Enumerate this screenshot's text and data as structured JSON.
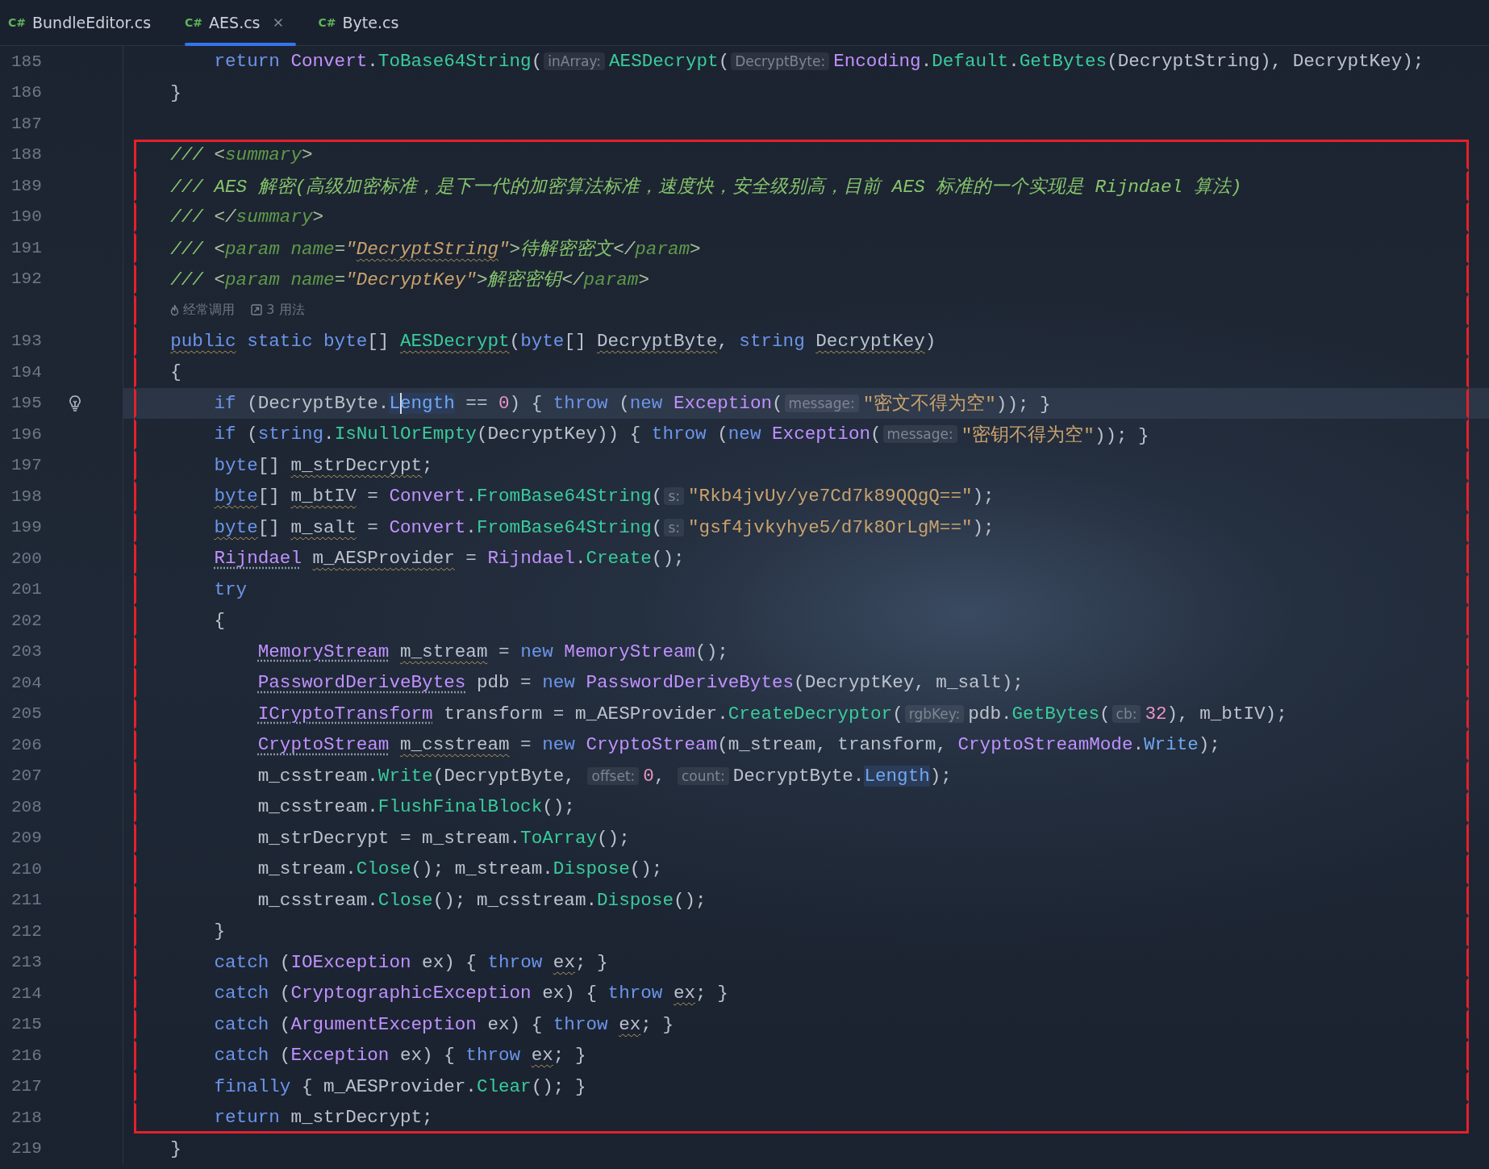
{
  "tabs": [
    {
      "lang": "C#",
      "label": "BundleEditor.cs",
      "selected": false
    },
    {
      "lang": "C#",
      "label": "AES.cs",
      "selected": true
    },
    {
      "lang": "C#",
      "label": "Byte.cs",
      "selected": false
    }
  ],
  "lines": [
    {
      "kind": "code",
      "number": "185",
      "boxed": false,
      "current": false,
      "tokens": [
        {
          "kind": "kw",
          "text": "        return"
        },
        {
          "kind": "type",
          "text": " Convert"
        },
        {
          "kind": "plain",
          "text": "."
        },
        {
          "kind": "method",
          "text": "ToBase64String"
        },
        {
          "kind": "plain",
          "text": "("
        },
        {
          "kind": "hint",
          "text": "inArray:"
        },
        {
          "kind": "method",
          "text": "AESDecrypt"
        },
        {
          "kind": "plain",
          "text": "("
        },
        {
          "kind": "hint",
          "text": "DecryptByte:"
        },
        {
          "kind": "type",
          "text": "Encoding"
        },
        {
          "kind": "plain",
          "text": "."
        },
        {
          "kind": "method",
          "text": "Default"
        },
        {
          "kind": "plain",
          "text": "."
        },
        {
          "kind": "method",
          "text": "GetBytes"
        },
        {
          "kind": "plain",
          "text": "(DecryptString), DecryptKey);"
        }
      ]
    },
    {
      "kind": "code",
      "number": "186",
      "boxed": false,
      "current": false,
      "tokens": [
        {
          "kind": "plain",
          "text": "    }"
        }
      ]
    },
    {
      "kind": "code",
      "number": "187",
      "boxed": false,
      "current": false
    },
    {
      "kind": "code",
      "number": "188",
      "boxed": true,
      "current": false,
      "tokens": [
        {
          "kind": "doc-slash",
          "text": "    ///"
        },
        {
          "kind": "doc-punct",
          "text": " <"
        },
        {
          "kind": "doc-tag",
          "text": "summary"
        },
        {
          "kind": "doc-punct",
          "text": ">"
        }
      ]
    },
    {
      "kind": "code",
      "number": "189",
      "boxed": true,
      "current": false,
      "tokens": [
        {
          "kind": "doc-slash",
          "text": "    ///"
        },
        {
          "kind": "comment",
          "text": " AES 解密(高级加密标准，是下一代的加密算法标准，速度快，安全级别高，目前 AES 标准的一个实现是 Rijndael 算法)"
        }
      ]
    },
    {
      "kind": "code",
      "number": "190",
      "boxed": true,
      "current": false,
      "tokens": [
        {
          "kind": "doc-slash",
          "text": "    ///"
        },
        {
          "kind": "doc-punct",
          "text": " </"
        },
        {
          "kind": "doc-tag",
          "text": "summary"
        },
        {
          "kind": "doc-punct",
          "text": ">"
        }
      ]
    },
    {
      "kind": "code",
      "number": "191",
      "boxed": true,
      "current": false,
      "tokens": [
        {
          "kind": "doc-slash",
          "text": "    ///"
        },
        {
          "kind": "doc-punct",
          "text": " <"
        },
        {
          "kind": "doc-tag",
          "text": "param name"
        },
        {
          "kind": "doc-punct",
          "text": "="
        },
        {
          "kind": "doc-value",
          "text": "\""
        },
        {
          "kind": "doc-value",
          "text": "DecryptString",
          "warning": true
        },
        {
          "kind": "doc-value",
          "text": "\""
        },
        {
          "kind": "doc-punct",
          "text": ">"
        },
        {
          "kind": "comment",
          "text": "待解密密文"
        },
        {
          "kind": "doc-punct",
          "text": "</"
        },
        {
          "kind": "doc-tag",
          "text": "param"
        },
        {
          "kind": "doc-punct",
          "text": ">"
        }
      ]
    },
    {
      "kind": "code",
      "number": "192",
      "boxed": true,
      "current": false,
      "tokens": [
        {
          "kind": "doc-slash",
          "text": "    ///"
        },
        {
          "kind": "doc-punct",
          "text": " <"
        },
        {
          "kind": "doc-tag",
          "text": "param name"
        },
        {
          "kind": "doc-punct",
          "text": "="
        },
        {
          "kind": "doc-value",
          "text": "\"DecryptKey\""
        },
        {
          "kind": "doc-punct",
          "text": ">"
        },
        {
          "kind": "comment",
          "text": "解密密钥"
        },
        {
          "kind": "doc-punct",
          "text": "</"
        },
        {
          "kind": "doc-tag",
          "text": "param"
        },
        {
          "kind": "doc-punct",
          "text": ">"
        }
      ]
    },
    {
      "kind": "inlay",
      "boxed": true,
      "items": [
        {
          "kind": "flame",
          "text": "经常调用"
        },
        {
          "kind": "usages",
          "text": "3 用法"
        }
      ]
    },
    {
      "kind": "code",
      "number": "193",
      "boxed": true,
      "current": false,
      "tokens": [
        {
          "kind": "kw",
          "text": "    public",
          "warning": true
        },
        {
          "kind": "kw",
          "text": " static byte"
        },
        {
          "kind": "plain",
          "text": "[] "
        },
        {
          "kind": "method",
          "text": "AESDecrypt",
          "warning": true
        },
        {
          "kind": "plain",
          "text": "("
        },
        {
          "kind": "kw",
          "text": "byte"
        },
        {
          "kind": "plain",
          "text": "[] "
        },
        {
          "kind": "plain",
          "text": "DecryptByte",
          "warning": true
        },
        {
          "kind": "plain",
          "text": ", "
        },
        {
          "kind": "kw",
          "text": "string"
        },
        {
          "kind": "plain",
          "text": " DecryptKey",
          "warning": true
        },
        {
          "kind": "plain",
          "text": ")"
        }
      ]
    },
    {
      "kind": "code",
      "number": "194",
      "boxed": true,
      "current": false,
      "tokens": [
        {
          "kind": "plain",
          "text": "    {"
        }
      ]
    },
    {
      "kind": "code",
      "number": "195",
      "boxed": true,
      "current": true,
      "tokens": [
        {
          "kind": "kw",
          "text": "        if"
        },
        {
          "kind": "plain",
          "text": " (DecryptByte."
        },
        {
          "kind": "member",
          "text": "L",
          "highlight": true
        },
        {
          "kind": "member",
          "text": "ength",
          "highlight": true,
          "caret": true
        },
        {
          "kind": "plain",
          "text": " == "
        },
        {
          "kind": "num",
          "text": "0"
        },
        {
          "kind": "plain",
          "text": ") { "
        },
        {
          "kind": "kw",
          "text": "throw"
        },
        {
          "kind": "plain",
          "text": " ("
        },
        {
          "kind": "kw",
          "text": "new"
        },
        {
          "kind": "type",
          "text": " Exception"
        },
        {
          "kind": "plain",
          "text": "("
        },
        {
          "kind": "hint",
          "text": "message:"
        },
        {
          "kind": "str",
          "text": "\"密文不得为空\""
        },
        {
          "kind": "plain",
          "text": ")); }"
        }
      ]
    },
    {
      "kind": "code",
      "number": "196",
      "boxed": true,
      "current": false,
      "tokens": [
        {
          "kind": "kw",
          "text": "        if"
        },
        {
          "kind": "plain",
          "text": " ("
        },
        {
          "kind": "kw",
          "text": "string"
        },
        {
          "kind": "plain",
          "text": "."
        },
        {
          "kind": "method",
          "text": "IsNullOrEmpty"
        },
        {
          "kind": "plain",
          "text": "(DecryptKey)) { "
        },
        {
          "kind": "kw",
          "text": "throw"
        },
        {
          "kind": "plain",
          "text": " ("
        },
        {
          "kind": "kw",
          "text": "new"
        },
        {
          "kind": "type",
          "text": " Exception"
        },
        {
          "kind": "plain",
          "text": "("
        },
        {
          "kind": "hint",
          "text": "message:"
        },
        {
          "kind": "str",
          "text": "\"密钥不得为空\""
        },
        {
          "kind": "plain",
          "text": ")); }"
        }
      ]
    },
    {
      "kind": "code",
      "number": "197",
      "boxed": true,
      "current": false,
      "tokens": [
        {
          "kind": "kw",
          "text": "        byte"
        },
        {
          "kind": "plain",
          "text": "[] "
        },
        {
          "kind": "plain",
          "text": "m_strDecrypt",
          "warning": true
        },
        {
          "kind": "plain",
          "text": ";"
        }
      ]
    },
    {
      "kind": "code",
      "number": "198",
      "boxed": true,
      "current": false,
      "tokens": [
        {
          "kind": "kw",
          "text": "        byte",
          "warning": true
        },
        {
          "kind": "plain",
          "text": "[] "
        },
        {
          "kind": "plain",
          "text": "m_btIV",
          "warning": true
        },
        {
          "kind": "plain",
          "text": " = "
        },
        {
          "kind": "type",
          "text": "Convert"
        },
        {
          "kind": "plain",
          "text": "."
        },
        {
          "kind": "method",
          "text": "FromBase64String"
        },
        {
          "kind": "plain",
          "text": "("
        },
        {
          "kind": "hint",
          "text": "s:"
        },
        {
          "kind": "str",
          "text": "\"Rkb4jvUy/ye7Cd7k89QQgQ==\""
        },
        {
          "kind": "plain",
          "text": ");"
        }
      ]
    },
    {
      "kind": "code",
      "number": "199",
      "boxed": true,
      "current": false,
      "tokens": [
        {
          "kind": "kw",
          "text": "        byte",
          "warning": true
        },
        {
          "kind": "plain",
          "text": "[] "
        },
        {
          "kind": "plain",
          "text": "m_salt",
          "warning": true
        },
        {
          "kind": "plain",
          "text": " = "
        },
        {
          "kind": "type",
          "text": "Convert"
        },
        {
          "kind": "plain",
          "text": "."
        },
        {
          "kind": "method",
          "text": "FromBase64String"
        },
        {
          "kind": "plain",
          "text": "("
        },
        {
          "kind": "hint",
          "text": "s:"
        },
        {
          "kind": "str",
          "text": "\"gsf4jvkyhye5/d7k8OrLgM==\""
        },
        {
          "kind": "plain",
          "text": ");"
        }
      ]
    },
    {
      "kind": "code",
      "number": "200",
      "boxed": true,
      "current": false,
      "tokens": [
        {
          "kind": "type",
          "text": "        Rijndael",
          "suggestion": true
        },
        {
          "kind": "plain",
          "text": " m_AESProvider",
          "warning": true
        },
        {
          "kind": "plain",
          "text": " = "
        },
        {
          "kind": "type",
          "text": "Rijndael"
        },
        {
          "kind": "plain",
          "text": "."
        },
        {
          "kind": "method",
          "text": "Create"
        },
        {
          "kind": "plain",
          "text": "();"
        }
      ]
    },
    {
      "kind": "code",
      "number": "201",
      "boxed": true,
      "current": false,
      "tokens": [
        {
          "kind": "kw",
          "text": "        try"
        }
      ]
    },
    {
      "kind": "code",
      "number": "202",
      "boxed": true,
      "current": false,
      "tokens": [
        {
          "kind": "plain",
          "text": "        {"
        }
      ]
    },
    {
      "kind": "code",
      "number": "203",
      "boxed": true,
      "current": false,
      "tokens": [
        {
          "kind": "type",
          "text": "            MemoryStream",
          "suggestion": true
        },
        {
          "kind": "plain",
          "text": " m_stream",
          "warning": true
        },
        {
          "kind": "plain",
          "text": " = "
        },
        {
          "kind": "kw",
          "text": "new"
        },
        {
          "kind": "type",
          "text": " MemoryStream"
        },
        {
          "kind": "plain",
          "text": "();"
        }
      ]
    },
    {
      "kind": "code",
      "number": "204",
      "boxed": true,
      "current": false,
      "tokens": [
        {
          "kind": "type",
          "text": "            PasswordDeriveBytes",
          "suggestion": true
        },
        {
          "kind": "plain",
          "text": " pdb = "
        },
        {
          "kind": "kw",
          "text": "new"
        },
        {
          "kind": "type",
          "text": " PasswordDeriveBytes"
        },
        {
          "kind": "plain",
          "text": "(DecryptKey, m_salt);"
        }
      ]
    },
    {
      "kind": "code",
      "number": "205",
      "boxed": true,
      "current": false,
      "tokens": [
        {
          "kind": "type",
          "text": "            ICryptoTransform",
          "suggestion": true
        },
        {
          "kind": "plain",
          "text": " transform = m_AESProvider."
        },
        {
          "kind": "method",
          "text": "CreateDecryptor"
        },
        {
          "kind": "plain",
          "text": "("
        },
        {
          "kind": "hint",
          "text": "rgbKey:"
        },
        {
          "kind": "plain",
          "text": "pdb."
        },
        {
          "kind": "method",
          "text": "GetBytes"
        },
        {
          "kind": "plain",
          "text": "("
        },
        {
          "kind": "hint",
          "text": "cb:"
        },
        {
          "kind": "num",
          "text": "32"
        },
        {
          "kind": "plain",
          "text": "), m_btIV);"
        }
      ]
    },
    {
      "kind": "code",
      "number": "206",
      "boxed": true,
      "current": false,
      "tokens": [
        {
          "kind": "type",
          "text": "            CryptoStream",
          "suggestion": true
        },
        {
          "kind": "plain",
          "text": " m_csstream",
          "warning": true
        },
        {
          "kind": "plain",
          "text": " = "
        },
        {
          "kind": "kw",
          "text": "new"
        },
        {
          "kind": "type",
          "text": " CryptoStream"
        },
        {
          "kind": "plain",
          "text": "(m_stream, transform, "
        },
        {
          "kind": "type",
          "text": "CryptoStreamMode"
        },
        {
          "kind": "plain",
          "text": "."
        },
        {
          "kind": "member",
          "text": "Write"
        },
        {
          "kind": "plain",
          "text": ");"
        }
      ]
    },
    {
      "kind": "code",
      "number": "207",
      "boxed": true,
      "current": false,
      "tokens": [
        {
          "kind": "plain",
          "text": "            m_csstream."
        },
        {
          "kind": "method",
          "text": "Write"
        },
        {
          "kind": "plain",
          "text": "(DecryptByte, "
        },
        {
          "kind": "hint",
          "text": "offset:"
        },
        {
          "kind": "num",
          "text": "0"
        },
        {
          "kind": "plain",
          "text": ", "
        },
        {
          "kind": "hint",
          "text": "count:"
        },
        {
          "kind": "plain",
          "text": "DecryptByte."
        },
        {
          "kind": "member",
          "text": "Length",
          "highlight": true
        },
        {
          "kind": "plain",
          "text": ");"
        }
      ]
    },
    {
      "kind": "code",
      "number": "208",
      "boxed": true,
      "current": false,
      "tokens": [
        {
          "kind": "plain",
          "text": "            m_csstream."
        },
        {
          "kind": "method",
          "text": "FlushFinalBlock"
        },
        {
          "kind": "plain",
          "text": "();"
        }
      ]
    },
    {
      "kind": "code",
      "number": "209",
      "boxed": true,
      "current": false,
      "tokens": [
        {
          "kind": "plain",
          "text": "            m_strDecrypt = m_stream."
        },
        {
          "kind": "method",
          "text": "ToArray"
        },
        {
          "kind": "plain",
          "text": "();"
        }
      ]
    },
    {
      "kind": "code",
      "number": "210",
      "boxed": true,
      "current": false,
      "tokens": [
        {
          "kind": "plain",
          "text": "            m_stream."
        },
        {
          "kind": "method",
          "text": "Close"
        },
        {
          "kind": "plain",
          "text": "(); m_stream."
        },
        {
          "kind": "method",
          "text": "Dispose"
        },
        {
          "kind": "plain",
          "text": "();"
        }
      ]
    },
    {
      "kind": "code",
      "number": "211",
      "boxed": true,
      "current": false,
      "tokens": [
        {
          "kind": "plain",
          "text": "            m_csstream."
        },
        {
          "kind": "method",
          "text": "Close"
        },
        {
          "kind": "plain",
          "text": "(); m_csstream."
        },
        {
          "kind": "method",
          "text": "Dispose"
        },
        {
          "kind": "plain",
          "text": "();"
        }
      ]
    },
    {
      "kind": "code",
      "number": "212",
      "boxed": true,
      "current": false,
      "tokens": [
        {
          "kind": "plain",
          "text": "        }"
        }
      ]
    },
    {
      "kind": "code",
      "number": "213",
      "boxed": true,
      "current": false,
      "tokens": [
        {
          "kind": "kw",
          "text": "        catch"
        },
        {
          "kind": "plain",
          "text": " ("
        },
        {
          "kind": "type",
          "text": "IOException"
        },
        {
          "kind": "plain",
          "text": " ex) { "
        },
        {
          "kind": "kw",
          "text": "throw"
        },
        {
          "kind": "plain",
          "text": " ex",
          "warning": true
        },
        {
          "kind": "plain",
          "text": "; }"
        }
      ]
    },
    {
      "kind": "code",
      "number": "214",
      "boxed": true,
      "current": false,
      "tokens": [
        {
          "kind": "kw",
          "text": "        catch"
        },
        {
          "kind": "plain",
          "text": " ("
        },
        {
          "kind": "type",
          "text": "CryptographicException"
        },
        {
          "kind": "plain",
          "text": " ex) { "
        },
        {
          "kind": "kw",
          "text": "throw"
        },
        {
          "kind": "plain",
          "text": " ex",
          "warning": true
        },
        {
          "kind": "plain",
          "text": "; }"
        }
      ]
    },
    {
      "kind": "code",
      "number": "215",
      "boxed": true,
      "current": false,
      "tokens": [
        {
          "kind": "kw",
          "text": "        catch"
        },
        {
          "kind": "plain",
          "text": " ("
        },
        {
          "kind": "type",
          "text": "ArgumentException"
        },
        {
          "kind": "plain",
          "text": " ex) { "
        },
        {
          "kind": "kw",
          "text": "throw"
        },
        {
          "kind": "plain",
          "text": " ex",
          "warning": true
        },
        {
          "kind": "plain",
          "text": "; }"
        }
      ]
    },
    {
      "kind": "code",
      "number": "216",
      "boxed": true,
      "current": false,
      "tokens": [
        {
          "kind": "kw",
          "text": "        catch"
        },
        {
          "kind": "plain",
          "text": " ("
        },
        {
          "kind": "type",
          "text": "Exception"
        },
        {
          "kind": "plain",
          "text": " ex) { "
        },
        {
          "kind": "kw",
          "text": "throw"
        },
        {
          "kind": "plain",
          "text": " ex",
          "warning": true
        },
        {
          "kind": "plain",
          "text": "; }"
        }
      ]
    },
    {
      "kind": "code",
      "number": "217",
      "boxed": true,
      "current": false,
      "tokens": [
        {
          "kind": "kw",
          "text": "        finally"
        },
        {
          "kind": "plain",
          "text": " { m_AESProvider."
        },
        {
          "kind": "method",
          "text": "Clear"
        },
        {
          "kind": "plain",
          "text": "(); }"
        }
      ]
    },
    {
      "kind": "code",
      "number": "218",
      "boxed": true,
      "current": false,
      "tokens": [
        {
          "kind": "kw",
          "text": "        return"
        },
        {
          "kind": "plain",
          "text": " m_strDecrypt;"
        }
      ]
    },
    {
      "kind": "code",
      "number": "219",
      "boxed": false,
      "current": false,
      "tokens": [
        {
          "kind": "plain",
          "text": "    }"
        }
      ]
    }
  ]
}
